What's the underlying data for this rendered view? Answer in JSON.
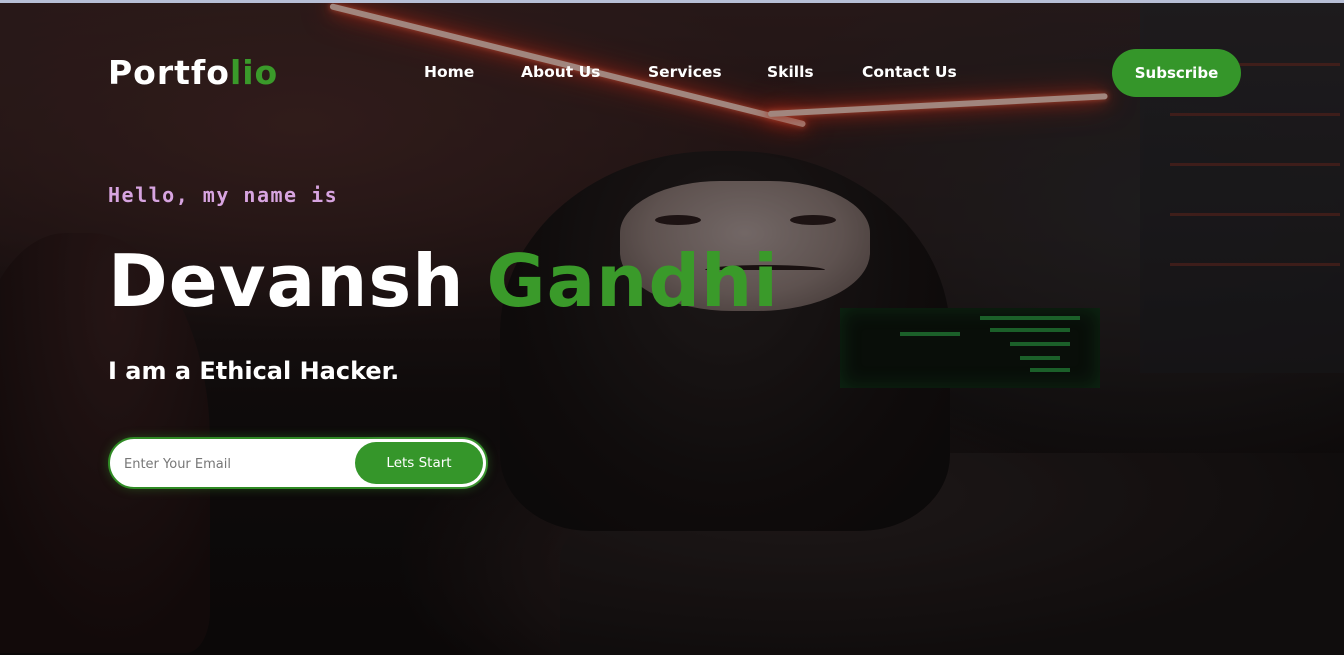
{
  "nav": {
    "logo_main": "Portfo",
    "logo_accent": "lio",
    "links": [
      "Home",
      "About Us",
      "Services",
      "Skills",
      "Contact Us"
    ],
    "subscribe_label": "Subscribe"
  },
  "hero": {
    "greeting": "Hello, my name is",
    "first_name": "Devansh",
    "last_name": "Gandhi",
    "tagline": "I am a Ethical Hacker.",
    "email_placeholder": "Enter Your Email",
    "cta_label": "Lets Start"
  },
  "colors": {
    "accent_green": "#35962a",
    "greeting_purple": "#d7a4e0"
  }
}
